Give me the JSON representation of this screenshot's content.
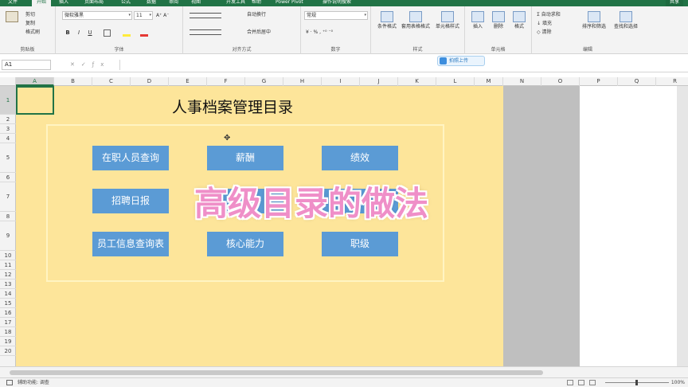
{
  "tabs": {
    "file": "文件",
    "home": "开始",
    "insert": "插入",
    "layout": "页面布局",
    "formula": "公式",
    "data": "数据",
    "review": "审阅",
    "view": "视图",
    "developer": "开发工具",
    "help": "帮助",
    "power_pivot": "Power Pivot",
    "tell_me": "操作说明搜索",
    "share": "共享"
  },
  "ribbon": {
    "clipboard": {
      "cut": "剪切",
      "copy": "复制",
      "format_painter": "格式刷",
      "label": "剪贴板"
    },
    "font": {
      "name": "微软雅黑",
      "size": "11",
      "bold": "B",
      "italic": "I",
      "underline": "U",
      "label": "字体"
    },
    "alignment": {
      "wrap": "自动换行",
      "merge": "合并后居中",
      "label": "对齐方式"
    },
    "number": {
      "format": "常规",
      "label": "数字"
    },
    "styles": {
      "conditional": "条件格式",
      "table": "套用表格格式",
      "cell_styles": "单元格样式",
      "label": "样式"
    },
    "cells": {
      "insert": "插入",
      "delete": "删除",
      "format": "格式",
      "label": "单元格"
    },
    "editing": {
      "autosum": "自动求和",
      "fill": "填充",
      "clear": "清除",
      "sort": "排序和筛选",
      "find": "查找和选择",
      "label": "编辑"
    }
  },
  "formula_bar": {
    "name_box": "A1",
    "value": ""
  },
  "upload_badge": "拍照上传",
  "columns": [
    "A",
    "B",
    "C",
    "D",
    "E",
    "F",
    "G",
    "H",
    "I",
    "J",
    "K",
    "L",
    "M",
    "N",
    "O",
    "P",
    "Q",
    "R"
  ],
  "rows": [
    "1",
    "2",
    "3",
    "4",
    "5",
    "6",
    "7",
    "8",
    "9",
    "10",
    "11",
    "12",
    "13",
    "14",
    "15",
    "16",
    "17",
    "18",
    "19",
    "20"
  ],
  "sheet": {
    "title": "人事档案管理目录",
    "buttons": [
      "在职人员查询",
      "薪酬",
      "绩效",
      "招聘日报",
      "",
      "",
      "员工信息查询表",
      "核心能力",
      "职级"
    ]
  },
  "overlay_caption": "高级目录的做法",
  "status": {
    "text": "辅助功能: 调查",
    "zoom": "100%"
  },
  "colors": {
    "excel_green": "#217346",
    "sheet_bg": "#fde59a",
    "button_blue": "#5b9bd5",
    "caption_pink": "#ef8fc8"
  }
}
